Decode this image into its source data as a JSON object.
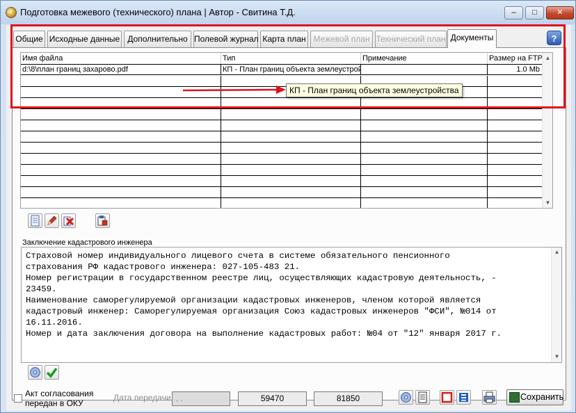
{
  "window": {
    "title": "Подготовка межевого (технического) плана | Автор - Свитина Т.Д.",
    "min_glyph": "–",
    "max_glyph": "□",
    "close_glyph": "✕"
  },
  "tabs": [
    {
      "label": "Общие",
      "state": "normal"
    },
    {
      "label": "Исходные данные",
      "state": "normal"
    },
    {
      "label": "Дополнительно",
      "state": "normal"
    },
    {
      "label": "Полевой журнал",
      "state": "normal"
    },
    {
      "label": "Карта план",
      "state": "normal"
    },
    {
      "label": "Межевой план",
      "state": "disabled"
    },
    {
      "label": "Технический план",
      "state": "disabled"
    },
    {
      "label": "Документы",
      "state": "active"
    }
  ],
  "help_glyph": "?",
  "documents_grid": {
    "columns": [
      "Имя файла",
      "Тип",
      "Примечание",
      "Размер на FTP"
    ],
    "rows": [
      {
        "file": "d:\\8\\план границ захарово.pdf",
        "type": "КП - План границ объекта землеустройства",
        "note": "",
        "size": "1.0 Mb"
      }
    ],
    "empty_rows": 12,
    "scroll_up": "▲",
    "scroll_down": "▼"
  },
  "tooltip": {
    "text": "КП - План границ объекта землеустройства"
  },
  "annotation": {
    "highlight_color": "#e0121e"
  },
  "grid_toolbar": [
    {
      "name": "new-document-button",
      "icon": "new-document-icon"
    },
    {
      "name": "edit-button",
      "icon": "pencil-icon"
    },
    {
      "name": "delete-button",
      "icon": "delete-icon"
    },
    {
      "name": "export-button",
      "icon": "export-icon"
    }
  ],
  "conclusion": {
    "label": "Заключение кадастрового инженера",
    "lines": [
      "Страховой номер индивидуального лицевого счета в системе обязательного пенсионного",
      "страхования РФ кадастрового инженера: 027-105-483 21.",
      "Номер регистрации в государственном реестре лиц, осуществляющих кадастровую деятельность, -",
      "23459.",
      "Наименование саморегулируемой организации кадастровых инженеров, членом которой является",
      "кадастровый инженер: Саморегулируемая организация Союз кадастровых инженеров \"ФСИ\", №014 от",
      "16.11.2016.",
      "Номер и дата заключения договора на выполнение кадастровых работ: №04 от \"12\" января 2017 г."
    ]
  },
  "footer": {
    "checkbox_label_line1": "Акт согласования",
    "checkbox_label_line2": "передан в ОКУ",
    "date_label": "Дата передачи",
    "date_value": ". .",
    "number1": "59470",
    "number2": "81850",
    "save_label": "Сохранить"
  }
}
